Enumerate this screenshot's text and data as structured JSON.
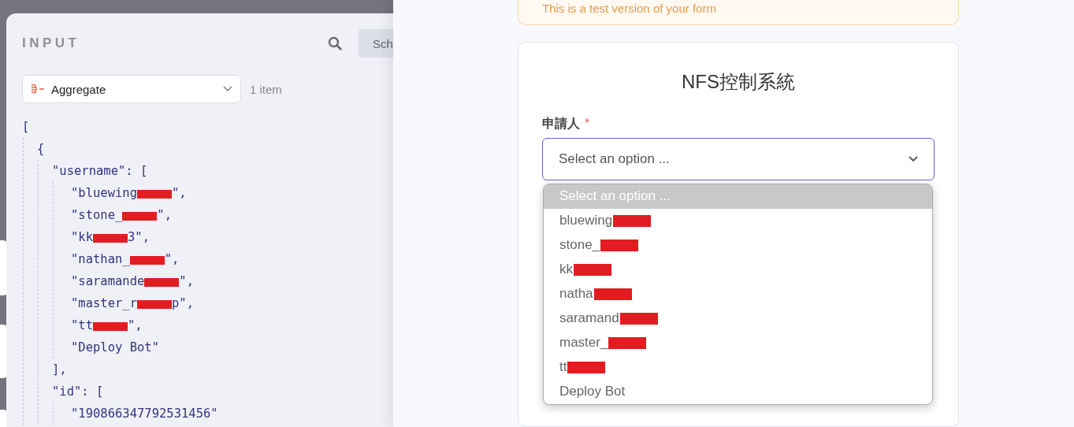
{
  "input_panel": {
    "title": "INPUT",
    "schema_button": "Sch",
    "node_select": {
      "value": "Aggregate"
    },
    "item_count": "1 item",
    "code": [
      {
        "text": "[",
        "children": [
          {
            "text": "{",
            "children": [
              {
                "text": "\"username\": [",
                "children": [
                  {
                    "text": "\"bluewing",
                    "redacted": true,
                    "after": "\","
                  },
                  {
                    "text": "\"stone_",
                    "redacted": true,
                    "after": "\","
                  },
                  {
                    "text": "\"kk",
                    "redacted": true,
                    "after": "3\","
                  },
                  {
                    "text": "\"nathan_",
                    "redacted": true,
                    "after": "\","
                  },
                  {
                    "text": "\"saramande",
                    "redacted": true,
                    "after": "\","
                  },
                  {
                    "text": "\"master_r",
                    "redacted": true,
                    "after": "p\","
                  },
                  {
                    "text": "\"tt",
                    "redacted": true,
                    "after": "\","
                  },
                  {
                    "text": "\"Deploy Bot\"",
                    "redacted": false
                  }
                ]
              },
              {
                "text": "],",
                "redacted": false
              },
              {
                "text": "\"id\": [",
                "children": [
                  {
                    "text": "\"190866347792531456\"",
                    "redacted": false
                  }
                ]
              }
            ]
          }
        ]
      }
    ]
  },
  "form_preview": {
    "notice": "This is a test version of your form",
    "title": "NFS控制系統",
    "field": {
      "label": "申請人",
      "required_mark": "*",
      "placeholder": "Select an option ...",
      "options": [
        {
          "label": "Select an option ...",
          "selected": true,
          "redacted": false
        },
        {
          "label": "bluewing",
          "selected": false,
          "redacted": true
        },
        {
          "label": "stone_",
          "selected": false,
          "redacted": true
        },
        {
          "label": "kk",
          "selected": false,
          "redacted": true
        },
        {
          "label": "natha",
          "selected": false,
          "redacted": true
        },
        {
          "label": "saramand",
          "selected": false,
          "redacted": true
        },
        {
          "label": "master_",
          "selected": false,
          "redacted": true
        },
        {
          "label": "tt",
          "selected": false,
          "redacted": true
        },
        {
          "label": "Deploy Bot",
          "selected": false,
          "redacted": false
        }
      ]
    }
  }
}
